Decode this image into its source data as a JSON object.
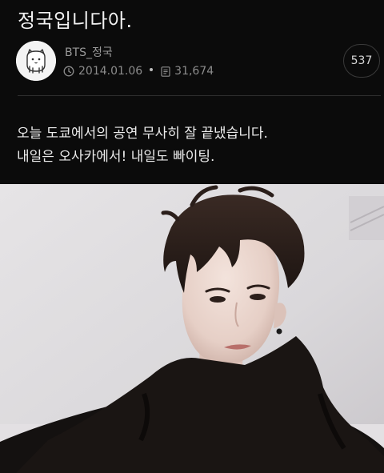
{
  "post": {
    "title": "정국입니다아.",
    "author": "BTS_정국",
    "date": "2014.01.06",
    "views": "31,674",
    "comment_count": "537",
    "body_lines": [
      "오늘 도쿄에서의 공연 무사히 잘 끝냈습니다.",
      "내일은 오사카에서! 내일도 빠이팅."
    ]
  },
  "icons": {
    "avatar": "bear-mascot-icon",
    "date": "clock-icon",
    "views": "document-icon"
  },
  "colors": {
    "background": "#0b0b0b",
    "text": "#ececec",
    "muted": "#8c8c8c"
  }
}
